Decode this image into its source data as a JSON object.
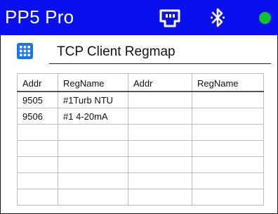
{
  "header": {
    "app_title": "PP5 Pro",
    "icons": [
      "ethernet-icon",
      "bluetooth-icon",
      "status-indicator"
    ],
    "status_color": "#12c32a",
    "bar_color": "#0a0ff0"
  },
  "page": {
    "icon": "grid-menu-icon",
    "title": "TCP Client Regmap"
  },
  "table": {
    "columns": [
      "Addr",
      "RegName",
      "Addr",
      "RegName"
    ],
    "rows": [
      [
        "9505",
        "#1Turb NTU",
        "",
        ""
      ],
      [
        "9506",
        "#1 4-20mA",
        "",
        ""
      ],
      [
        "",
        "",
        "",
        ""
      ],
      [
        "",
        "",
        "",
        ""
      ],
      [
        "",
        "",
        "",
        ""
      ],
      [
        "",
        "",
        "",
        ""
      ],
      [
        "",
        "",
        "",
        ""
      ]
    ]
  }
}
